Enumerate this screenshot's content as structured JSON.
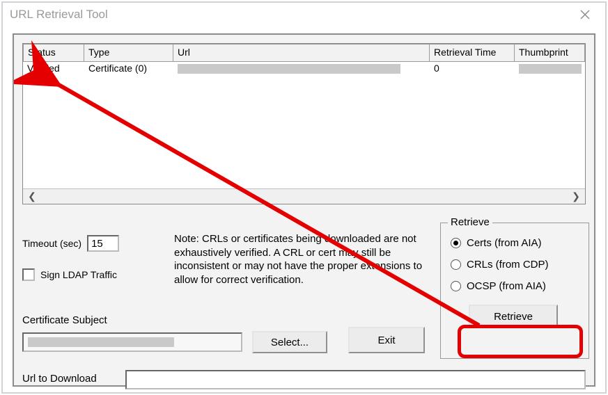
{
  "window": {
    "title": "URL Retrieval Tool"
  },
  "table": {
    "headers": {
      "status": "Status",
      "type": "Type",
      "url": "Url",
      "retrieval_time": "Retrieval Time",
      "thumbprint": "Thumbprint"
    },
    "rows": [
      {
        "status": "Verified",
        "type": "Certificate (0)",
        "url": "",
        "retrieval_time": "0",
        "thumbprint": ""
      }
    ]
  },
  "timeout_label": "Timeout (sec)",
  "timeout_value": "15",
  "sign_ldap_label": "Sign LDAP Traffic",
  "sign_ldap_checked": false,
  "note_text": "Note: CRLs or certificates being downloaded are not exhaustively verified.  A CRL or cert may still be inconsistent or may not have the proper extensions to allow for correct verification.",
  "certificate_subject_label": "Certificate Subject",
  "certificate_subject_value": "",
  "select_button": "Select...",
  "exit_button": "Exit",
  "retrieve_group": {
    "title": "Retrieve",
    "options": {
      "certs": "Certs (from AIA)",
      "crls": "CRLs (from CDP)",
      "ocsp": "OCSP (from AIA)"
    },
    "selected": "certs",
    "retrieve_button": "Retrieve"
  },
  "url_to_download_label": "Url to Download",
  "url_to_download_value": "",
  "annotations": {
    "arrow_color": "#e40000",
    "highlight_target": "retrieve-button"
  }
}
